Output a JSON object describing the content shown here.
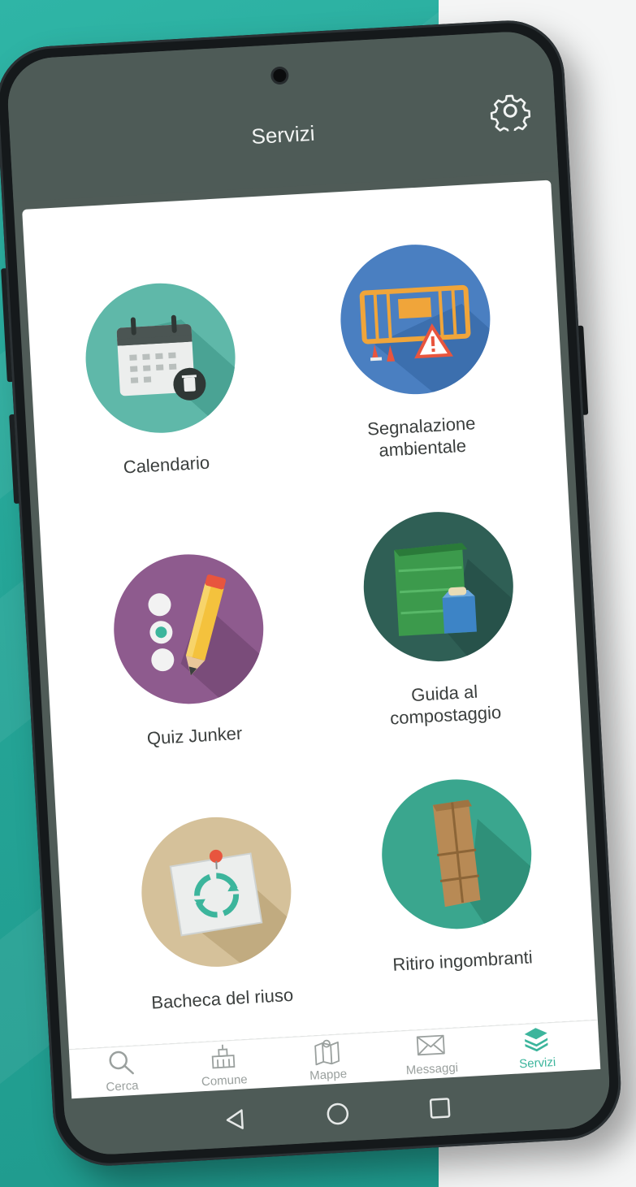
{
  "app": {
    "title": "Servizi"
  },
  "services": [
    {
      "label": "Calendario"
    },
    {
      "label": "Segnalazione\nambientale"
    },
    {
      "label": "Quiz Junker"
    },
    {
      "label": "Guida al\ncompostaggio"
    },
    {
      "label": "Bacheca del riuso"
    },
    {
      "label": "Ritiro ingombranti"
    }
  ],
  "tabs": [
    {
      "label": "Cerca",
      "icon": "search-icon"
    },
    {
      "label": "Comune",
      "icon": "town-hall-icon"
    },
    {
      "label": "Mappe",
      "icon": "map-icon"
    },
    {
      "label": "Messaggi",
      "icon": "mail-icon"
    },
    {
      "label": "Servizi",
      "icon": "layers-icon",
      "active": true
    }
  ],
  "colors": {
    "appbar": "#4e5b57",
    "accent": "#3cb59c",
    "background_teal": "#25a597"
  }
}
